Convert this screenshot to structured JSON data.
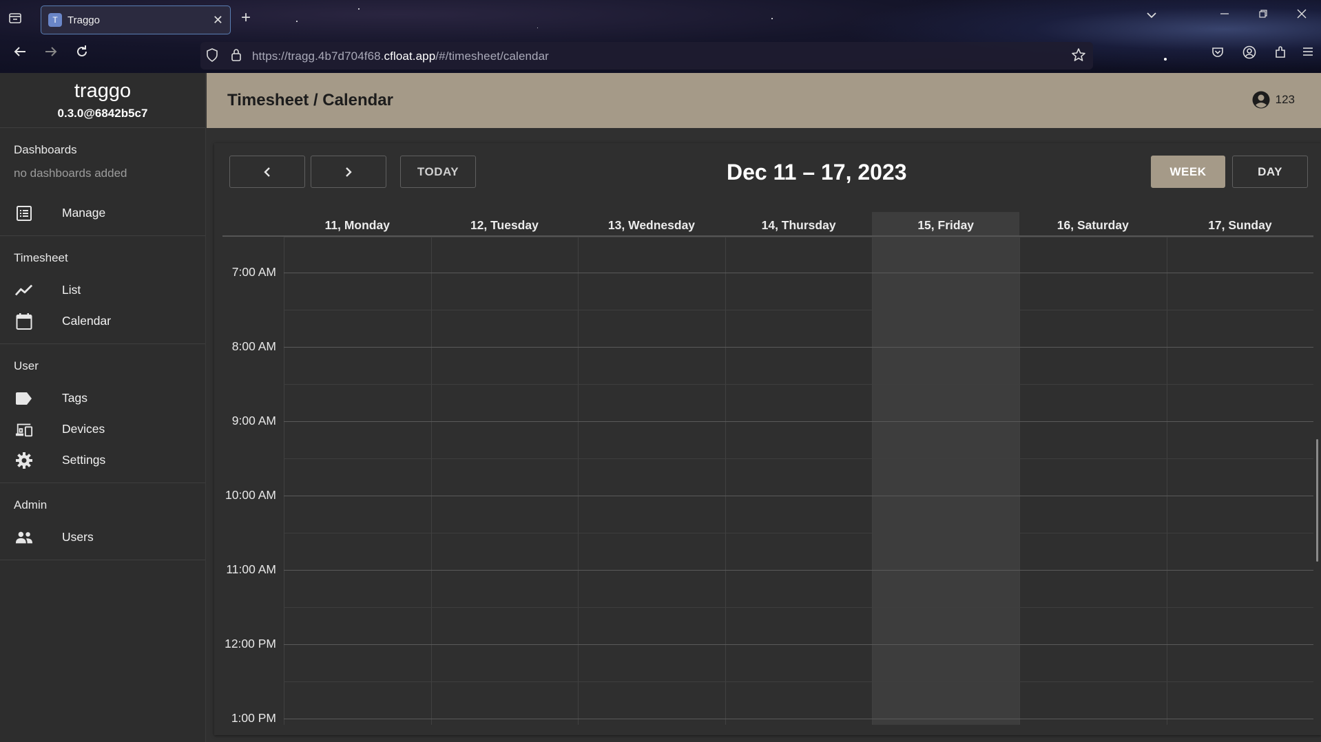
{
  "browser": {
    "tab_title": "Traggo",
    "url_prefix": "https://tragg.4b7d704f68.",
    "url_domain": "cfloat.app",
    "url_suffix": "/#/timesheet/calendar",
    "close_glyph": "✕",
    "newtab_glyph": "+"
  },
  "sidebar": {
    "app_name": "traggo",
    "version": "0.3.0@6842b5c7",
    "sections": [
      {
        "title": "Dashboards",
        "empty": "no dashboards added",
        "items": [
          {
            "label": "Manage",
            "icon": "list-icon"
          }
        ]
      },
      {
        "title": "Timesheet",
        "items": [
          {
            "label": "List",
            "icon": "trend-icon"
          },
          {
            "label": "Calendar",
            "icon": "calendar-icon"
          }
        ]
      },
      {
        "title": "User",
        "items": [
          {
            "label": "Tags",
            "icon": "tag-icon"
          },
          {
            "label": "Devices",
            "icon": "devices-icon"
          },
          {
            "label": "Settings",
            "icon": "gear-icon"
          }
        ]
      },
      {
        "title": "Admin",
        "items": [
          {
            "label": "Users",
            "icon": "people-icon"
          }
        ]
      }
    ]
  },
  "header": {
    "page_title": "Timesheet / Calendar",
    "user_name": "123"
  },
  "calendar": {
    "prev_glyph": "‹",
    "next_glyph": "›",
    "today_label": "TODAY",
    "title": "Dec 11 – 17, 2023",
    "week_label": "WEEK",
    "day_label": "DAY",
    "active_view": "WEEK",
    "days": [
      "11, Monday",
      "12, Tuesday",
      "13, Wednesday",
      "14, Thursday",
      "15, Friday",
      "16, Saturday",
      "17, Sunday"
    ],
    "today_index": 4,
    "times": [
      "7:00 AM",
      "8:00 AM",
      "9:00 AM",
      "10:00 AM",
      "11:00 AM",
      "12:00 PM",
      "1:00 PM"
    ]
  },
  "colors": {
    "accent": "#a59a88",
    "background": "#303030",
    "sidebar": "#2d2d2d",
    "today_column": "#3d3d3d"
  }
}
